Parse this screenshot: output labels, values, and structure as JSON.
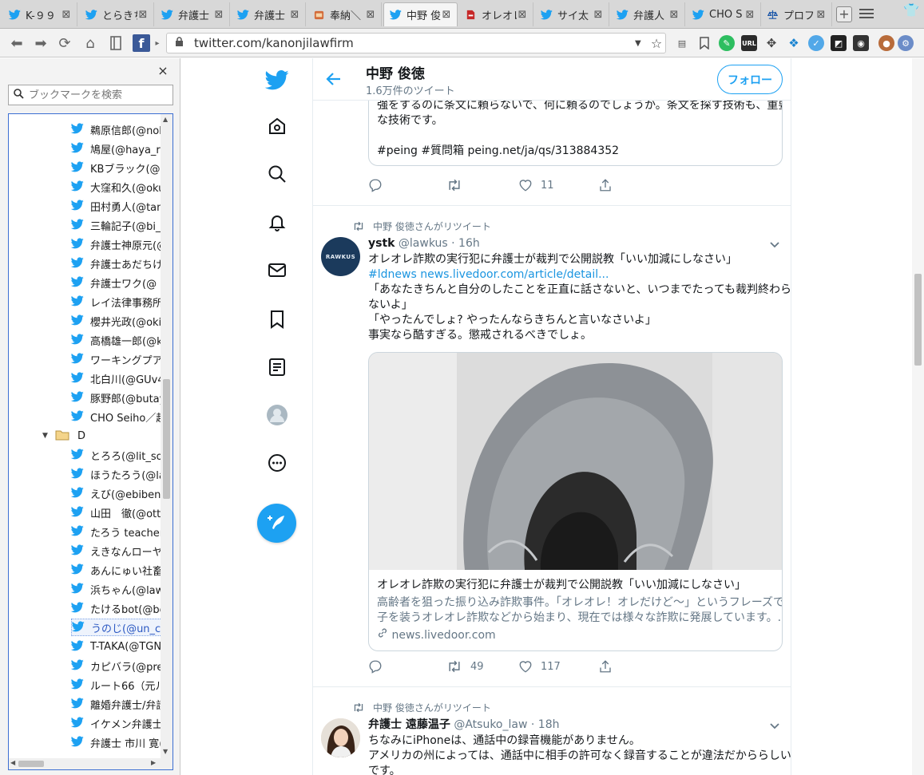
{
  "browser": {
    "tabs": [
      {
        "title": "K-９９",
        "icon": "twitter-icon"
      },
      {
        "title": "とらきち",
        "icon": "twitter-icon"
      },
      {
        "title": "弁護士",
        "icon": "twitter-icon"
      },
      {
        "title": "弁護士",
        "icon": "twitter-icon"
      },
      {
        "title": "奉納＼",
        "icon": "shrine-icon"
      },
      {
        "title": "中野 俊",
        "icon": "twitter-icon",
        "active": true
      },
      {
        "title": "オレオレ",
        "icon": "pdf-icon"
      },
      {
        "title": "サイ太",
        "icon": "twitter-icon"
      },
      {
        "title": "弁護人",
        "icon": "twitter-icon"
      },
      {
        "title": "CHO S",
        "icon": "twitter-icon"
      },
      {
        "title": "プロフィ",
        "icon": "scales-icon"
      }
    ],
    "url": "twitter.com/kanonjilawfirm",
    "new_tab": "+",
    "colors": {
      "twitter_blue": "#1da1f2",
      "link_blue": "#1b95e0",
      "gray_text": "#657786"
    }
  },
  "sidebar": {
    "close": "×",
    "search_placeholder": "ブックマークを検索",
    "items": [
      {
        "label": "鵜原信郎(@nob",
        "type": "bookmark"
      },
      {
        "label": "鳩屋(@haya_rt",
        "type": "bookmark"
      },
      {
        "label": "KBブラック(@be",
        "type": "bookmark"
      },
      {
        "label": "大窪和久(@oku",
        "type": "bookmark"
      },
      {
        "label": "田村勇人(@tam",
        "type": "bookmark"
      },
      {
        "label": "三輪記子(@bi_",
        "type": "bookmark"
      },
      {
        "label": "弁護士神原元(@",
        "type": "bookmark"
      },
      {
        "label": "弁護士あだちけ",
        "type": "bookmark"
      },
      {
        "label": "弁護士ワク(@",
        "type": "bookmark"
      },
      {
        "label": "レイ法律事務所",
        "type": "bookmark"
      },
      {
        "label": "櫻井光政(@oki",
        "type": "bookmark"
      },
      {
        "label": "高橋雄一郎(@k",
        "type": "bookmark"
      },
      {
        "label": "ワーキングプア弁",
        "type": "bookmark"
      },
      {
        "label": "北白川(@GUv4",
        "type": "bookmark"
      },
      {
        "label": "豚野郎(@butay",
        "type": "bookmark"
      },
      {
        "label": "CHO Seiho／趙",
        "type": "bookmark"
      },
      {
        "label": "D",
        "type": "folder"
      },
      {
        "label": "とろろ(@lit_soc",
        "type": "bookmark"
      },
      {
        "label": "ほうたろう(@law",
        "type": "bookmark"
      },
      {
        "label": "えび(@ebiben2",
        "type": "bookmark"
      },
      {
        "label": "山田　徹(@ott",
        "type": "bookmark"
      },
      {
        "label": "たろう teacher(",
        "type": "bookmark"
      },
      {
        "label": "えきなんローヤー",
        "type": "bookmark"
      },
      {
        "label": "あんにゅい社畜",
        "type": "bookmark"
      },
      {
        "label": "浜ちゃん(@lawe",
        "type": "bookmark"
      },
      {
        "label": "たけるbot(@be",
        "type": "bookmark"
      },
      {
        "label": "うのじ(@un_co",
        "type": "bookmark",
        "selected": true
      },
      {
        "label": "T-TAKA(@TGN",
        "type": "bookmark"
      },
      {
        "label": "カピバラ(@prej",
        "type": "bookmark"
      },
      {
        "label": "ルート66（元ル",
        "type": "bookmark"
      },
      {
        "label": "離婚弁護士/弁護",
        "type": "bookmark"
      },
      {
        "label": "イケメン弁護士(",
        "type": "bookmark"
      },
      {
        "label": "弁護士 市川 寛(",
        "type": "bookmark"
      }
    ]
  },
  "profile": {
    "name": "中野 俊徳",
    "tweet_count": "1.6万件のツイート",
    "follow": "フォロー"
  },
  "tweets": [
    {
      "partial_lines": [
        "強をするのに条文に頼らないで、何に頼るのでしょうか。条文を探す技術も、重要",
        "な技術です。",
        "",
        "#peing #質問箱 peing.net/ja/qs/313884352"
      ],
      "likes": "11"
    },
    {
      "retweeted_by": "中野 俊徳さんがリツイート",
      "author": "ystk",
      "handle": "@lawkus",
      "time": "16h",
      "avatar_text": "RAWKUS",
      "lines": [
        "オレオレ詐欺の実行犯に弁護士が裁判で公開説教「いい加減にしなさい」",
        "#ldnews news.livedoor.com/article/detail...",
        "「あなたきちんと自分のしたことを正直に話さないと、いつまでたっても裁判終わら",
        "ないよ」",
        "「やったんでしょ? やったんならきちんと言いなさいよ」",
        "事実なら酷すぎる。懲戒されるべきでしょ。"
      ],
      "link_hashtag": "#ldnews",
      "link_url": "news.livedoor.com/article/detail...",
      "card": {
        "title": "オレオレ詐欺の実行犯に弁護士が裁判で公開説教「いい加減にしなさい」",
        "desc1": "高齢者を狙った振り込み詐欺事件。「オレオレ！オレだけど〜」というフレーズで息",
        "desc2": "子を装うオレオレ詐欺などから始まり、現在では様々な詐欺に発展しています。...",
        "domain": "news.livedoor.com"
      },
      "retweets": "49",
      "likes": "117"
    },
    {
      "retweeted_by": "中野 俊徳さんがリツイート",
      "author": "弁護士 遠藤温子",
      "handle": "@Atsuko_law",
      "time": "18h",
      "lines": [
        "ちなみにiPhoneは、通話中の録音機能がありません。",
        "アメリカの州によっては、通話中に相手の許可なく録音することが違法だかららしい",
        "です。"
      ]
    }
  ]
}
